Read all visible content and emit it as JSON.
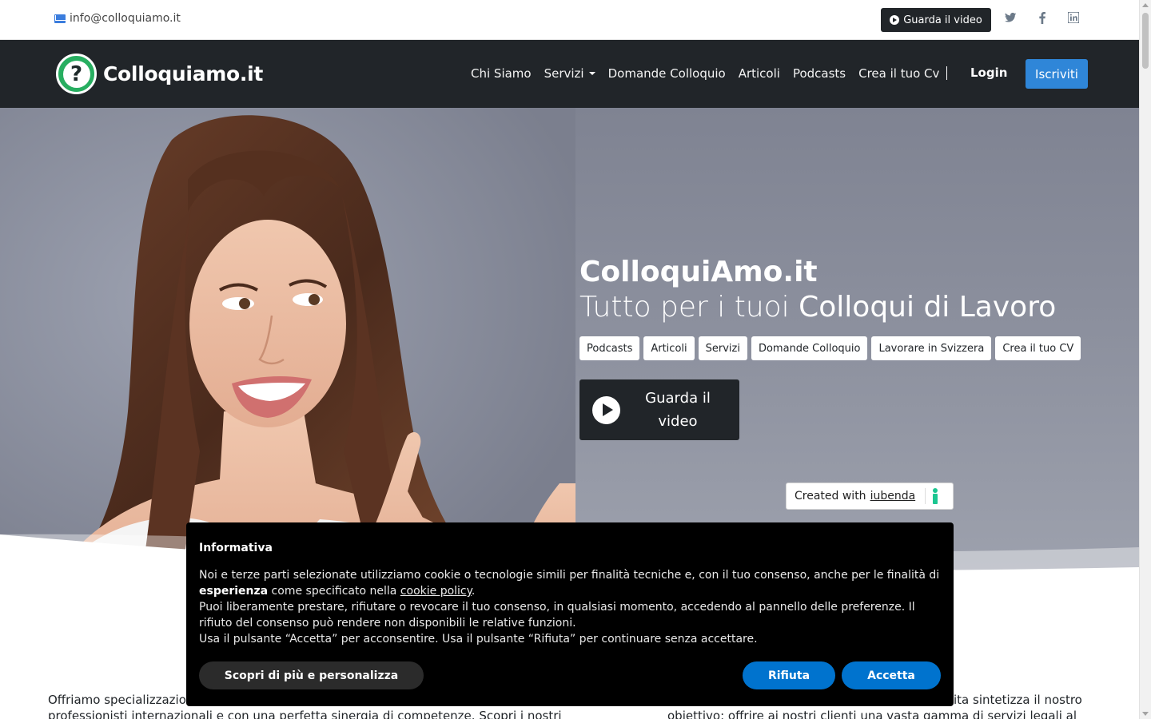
{
  "topbar": {
    "email": "info@colloquiamo.it",
    "video_button": "Guarda il video",
    "social_icons": [
      "twitter-icon",
      "facebook-icon",
      "linkedin-icon"
    ]
  },
  "navbar": {
    "logo_text": "Colloquiamo.it",
    "links": [
      "Chi Siamo",
      "Servizi",
      "Domande Colloquio",
      "Articoli",
      "Podcasts",
      "Crea il tuo Cv"
    ],
    "login": "Login",
    "signup": "Iscriviti"
  },
  "hero": {
    "title": "ColloquiAmo.it",
    "subtitle_light": "Tutto per i tuoi ",
    "subtitle_strong": "Colloqui di Lavoro",
    "tags": [
      "Podcasts",
      "Articoli",
      "Servizi",
      "Domande Colloquio",
      "Lavorare in Svizzera",
      "Crea il tuo CV"
    ],
    "video_button": "Guarda il video"
  },
  "iubenda": {
    "prefix": "Created with",
    "link": "iubenda"
  },
  "cookie_banner": {
    "title": "Informativa",
    "text_1": "Noi e terze parti selezionate utilizziamo cookie o tecnologie simili per finalità tecniche e, con il tuo consenso, anche per le finalità di ",
    "text_bold": "esperienza",
    "text_2": " come specificato nella ",
    "text_link": "cookie policy",
    "text_3": ".",
    "text_4": "Puoi liberamente prestare, rifiutare o revocare il tuo consenso, in qualsiasi momento, accedendo al pannello delle preferenze. Il rifiuto del consenso può rendere non disponibili le relative funzioni.",
    "text_5": "Usa il pulsante “Accetta” per acconsentire. Usa il pulsante “Rifiuta” per continuare senza accettare.",
    "btn_more": "Scopri di più e personalizza",
    "btn_reject": "Rifiuta",
    "btn_accept": "Accetta"
  },
  "body": {
    "left_text": "Offriamo specializzazion",
    "left_text_2": "professionisti internazionali e con una perfetta sinergia di competenze. Scopri i nostri servizi:",
    "right_text": "ita sintetizza il nostro",
    "right_text_2": "obiettivo: offrire ai nostri clienti una vasta gamma di servizi legali al"
  },
  "colors": {
    "navbar_bg": "#212529",
    "accent_blue": "#2f86d8",
    "cookie_button_blue": "#0073ce",
    "logo_green": "#27ae60",
    "iubenda_green": "#1cc691"
  }
}
